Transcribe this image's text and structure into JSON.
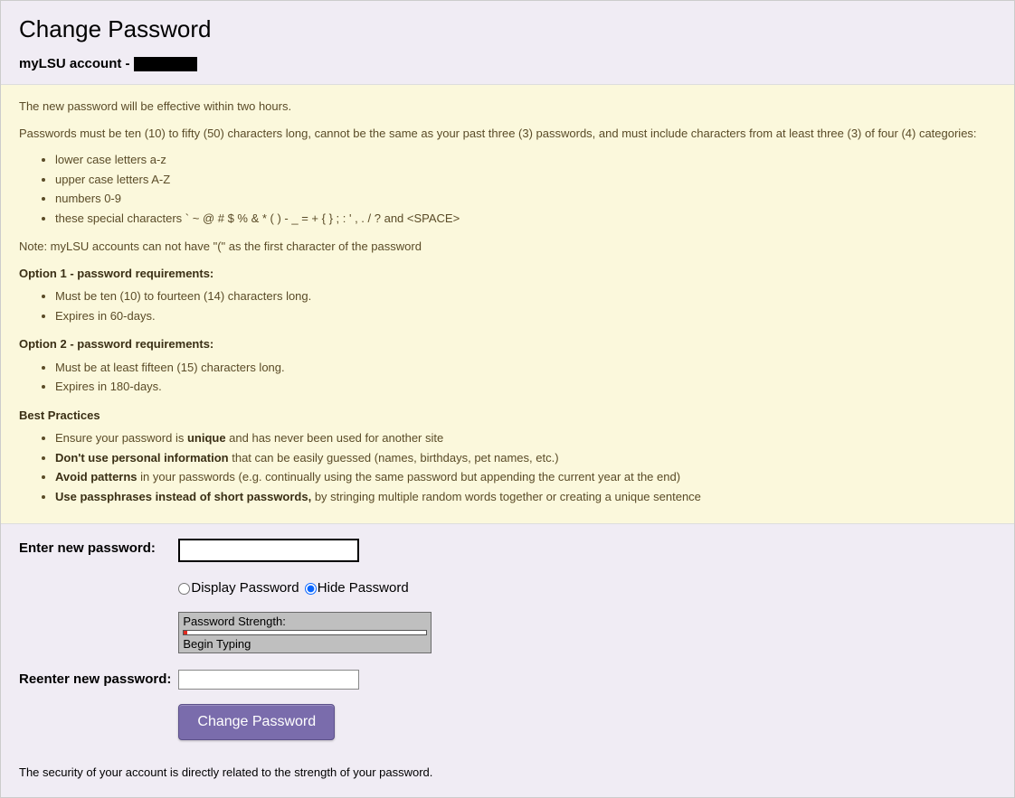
{
  "header": {
    "page_title": "Change Password",
    "account_prefix": "myLSU account - "
  },
  "instructions": {
    "intro_line": "The new password will be effective within two hours.",
    "rules_line": "Passwords must be ten (10) to fifty (50) characters long, cannot be the same as your past three (3) passwords, and must include characters from at least three (3) of four (4) categories:",
    "categories": [
      "lower case letters a-z",
      "upper case letters A-Z",
      "numbers 0-9",
      "these special characters ` ~ @ # $ % & * ( ) - _ = + { } ; : ' , . / ? and <SPACE>"
    ],
    "note_line": "Note: myLSU accounts can not have \"(\" as the first character of the password",
    "option1_head": "Option 1 - password requirements:",
    "option1_items": [
      "Must be ten (10) to fourteen (14) characters long.",
      "Expires in 60-days."
    ],
    "option2_head": "Option 2 - password requirements:",
    "option2_items": [
      "Must be at least fifteen (15) characters long.",
      "Expires in 180-days."
    ],
    "best_head": "Best Practices",
    "best_items": [
      {
        "b": "unique",
        "pre": "Ensure your password is ",
        "post": " and has never been used for another site"
      },
      {
        "b": "Don't use personal information",
        "pre": "",
        "post": " that can be easily guessed (names, birthdays, pet names, etc.)"
      },
      {
        "b": "Avoid patterns",
        "pre": "",
        "post": " in your passwords (e.g. continually using the same password but appending the current year at the end)"
      },
      {
        "b": "Use passphrases instead of short passwords,",
        "pre": "",
        "post": " by stringing multiple random words together or creating a unique sentence"
      }
    ]
  },
  "form": {
    "enter_label": "Enter new password:",
    "reenter_label": "Reenter new password:",
    "password_value": "",
    "reenter_value": "",
    "display_label": "Display Password",
    "hide_label": "Hide Password",
    "strength_title": "Password Strength:",
    "strength_status": "Begin Typing",
    "submit_label": "Change Password",
    "footer_note": "The security of your account is directly related to the strength of your password."
  }
}
